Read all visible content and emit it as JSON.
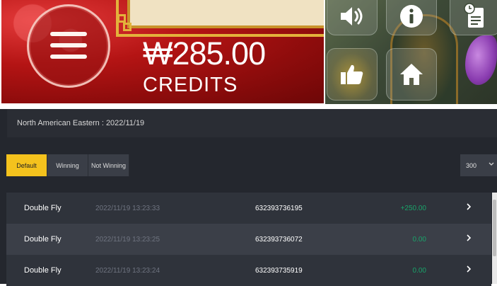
{
  "game": {
    "credits_amount": "₩285.00",
    "credits_label": "CREDITS",
    "controls": [
      {
        "name": "sound-button",
        "icon": "speaker-icon"
      },
      {
        "name": "info-button",
        "icon": "info-icon"
      },
      {
        "name": "history-button",
        "icon": "clock-document-icon"
      },
      {
        "name": "like-button",
        "icon": "thumbs-up-icon"
      },
      {
        "name": "home-button",
        "icon": "home-icon"
      }
    ],
    "menu_icon": "hamburger-menu-icon"
  },
  "history": {
    "timezone_label": "North American Eastern : 2022/11/19",
    "filters": {
      "default": "Default",
      "winning": "Winning",
      "not_winning": "Not Winning"
    },
    "page_size": "300",
    "rows": [
      {
        "game": "Double Fly",
        "time": "2022/11/19 13:23:33",
        "txn": "632393736195",
        "amount": "+250.00"
      },
      {
        "game": "Double Fly",
        "time": "2022/11/19 13:23:25",
        "txn": "632393736072",
        "amount": "0.00"
      },
      {
        "game": "Double Fly",
        "time": "2022/11/19 13:23:24",
        "txn": "632393735919",
        "amount": "0.00"
      }
    ]
  },
  "colors": {
    "accent_yellow": "#f4c21d",
    "win_green": "#19a36a",
    "panel_bg": "#24272e",
    "banner_red": "#b41414"
  }
}
